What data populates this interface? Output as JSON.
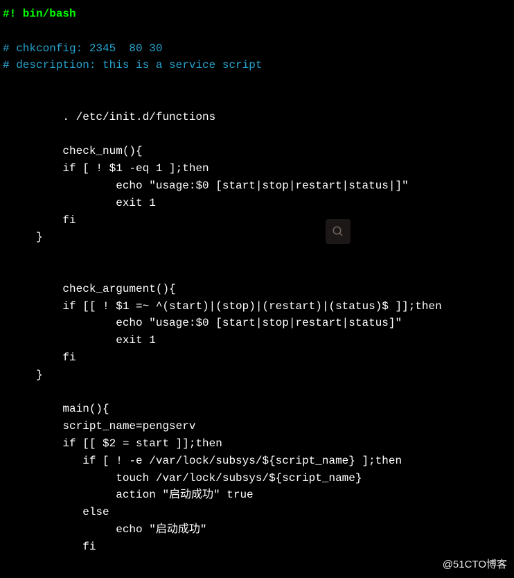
{
  "code": {
    "lines": [
      {
        "type": "shebang",
        "text": "#! bin/bash"
      },
      {
        "type": "blank",
        "text": ""
      },
      {
        "type": "comment",
        "text": "# chkconfig: 2345  80 30"
      },
      {
        "type": "comment",
        "text": "# description: this is a service script"
      },
      {
        "type": "blank",
        "text": ""
      },
      {
        "type": "blank",
        "text": ""
      },
      {
        "type": "code",
        "text": "         . /etc/init.d/functions"
      },
      {
        "type": "blank",
        "text": ""
      },
      {
        "type": "code",
        "text": "         check_num(){"
      },
      {
        "type": "code",
        "text": "         if [ ! $1 -eq 1 ];then"
      },
      {
        "type": "code",
        "text": "                 echo \"usage:$0 [start|stop|restart|status|]\""
      },
      {
        "type": "code",
        "text": "                 exit 1"
      },
      {
        "type": "code",
        "text": "         fi"
      },
      {
        "type": "code",
        "text": "     }"
      },
      {
        "type": "blank",
        "text": ""
      },
      {
        "type": "blank",
        "text": ""
      },
      {
        "type": "code",
        "text": "         check_argument(){"
      },
      {
        "type": "code",
        "text": "         if [[ ! $1 =~ ^(start)|(stop)|(restart)|(status)$ ]];then"
      },
      {
        "type": "code",
        "text": "                 echo \"usage:$0 [start|stop|restart|status]\""
      },
      {
        "type": "code",
        "text": "                 exit 1"
      },
      {
        "type": "code",
        "text": "         fi"
      },
      {
        "type": "code",
        "text": "     }"
      },
      {
        "type": "blank",
        "text": ""
      },
      {
        "type": "code",
        "text": "         main(){"
      },
      {
        "type": "code",
        "text": "         script_name=pengserv"
      },
      {
        "type": "code",
        "text": "         if [[ $2 = start ]];then"
      },
      {
        "type": "code",
        "text": "            if [ ! -e /var/lock/subsys/${script_name} ];then"
      },
      {
        "type": "code",
        "text": "                 touch /var/lock/subsys/${script_name}"
      },
      {
        "type": "code",
        "text": "                 action \"启动成功\" true"
      },
      {
        "type": "code",
        "text": "            else"
      },
      {
        "type": "code",
        "text": "                 echo \"启动成功\""
      },
      {
        "type": "code",
        "text": "            fi"
      }
    ]
  },
  "overlay": {
    "search_icon_name": "search-icon"
  },
  "watermark": {
    "text": "@51CTO博客"
  }
}
